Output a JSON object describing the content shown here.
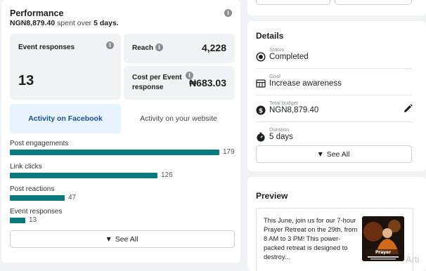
{
  "performance": {
    "title": "Performance",
    "amount": "NGN8,879.40",
    "spent_over": "spent over",
    "days": "5 days.",
    "metrics": {
      "event_responses_label": "Event responses",
      "event_responses_value": "13",
      "reach_label": "Reach",
      "reach_value": "4,228",
      "cost_label": "Cost per Event response",
      "cost_value": "₦683.03"
    },
    "tabs": {
      "facebook": "Activity on Facebook",
      "website": "Activity on your website"
    },
    "bars": [
      {
        "label": "Post engagements",
        "value": 179
      },
      {
        "label": "Link clicks",
        "value": 126
      },
      {
        "label": "Post reactions",
        "value": 47
      },
      {
        "label": "Event responses",
        "value": 13
      }
    ],
    "bar_values_text": [
      "179",
      "126",
      "47",
      "13"
    ],
    "see_all": "See All"
  },
  "details": {
    "title": "Details",
    "status_label": "Status",
    "status_value": "Completed",
    "goal_label": "Goal",
    "goal_value": "Increase awareness",
    "budget_label": "Total budget",
    "budget_value": "NGN8,879.40",
    "duration_label": "Duration",
    "duration_value": "5 days",
    "see_all": "See All"
  },
  "preview": {
    "title": "Preview",
    "text": "This June, join us for our 7-hour Prayer Retreat on the 29th, from 8 AM to 3 PM! This power-packed retreat is designed to destroy...",
    "thumb_title": "Prayer"
  },
  "watermark": "Arti",
  "colors": {
    "bar": "#0a7a7f",
    "tab_active_bg": "#e7f3ff",
    "tab_active_text": "#1b4f8a"
  }
}
